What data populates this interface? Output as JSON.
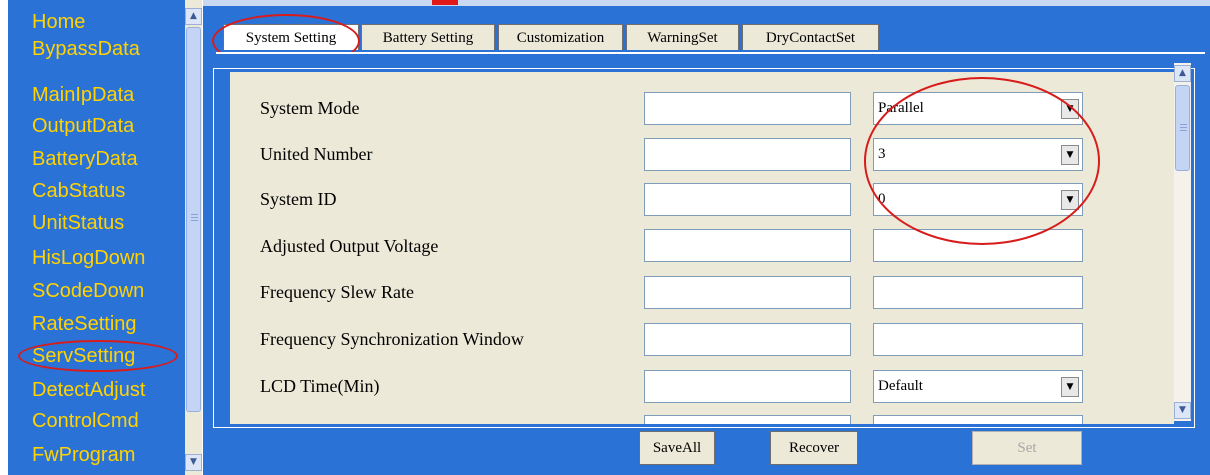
{
  "nav": {
    "items": [
      "Home",
      "BypassData",
      "MainIpData",
      "OutputData",
      "BatteryData",
      "CabStatus",
      "UnitStatus",
      "HisLogDown",
      "SCodeDown",
      "RateSetting",
      "ServSetting",
      "DetectAdjust",
      "ControlCmd",
      "FwProgram"
    ],
    "selected": "ServSetting"
  },
  "tabs": [
    "System Setting",
    "Battery Setting",
    "Customization",
    "WarningSet",
    "DryContactSet"
  ],
  "active_tab": "System Setting",
  "form": {
    "rows": [
      {
        "label": "System Mode",
        "input": "",
        "control": "select",
        "value": "Parallel"
      },
      {
        "label": "United Number",
        "input": "",
        "control": "select",
        "value": "3"
      },
      {
        "label": "System ID",
        "input": "",
        "control": "select",
        "value": "0"
      },
      {
        "label": "Adjusted Output Voltage",
        "input": "",
        "control": "text",
        "value": ""
      },
      {
        "label": "Frequency Slew Rate",
        "input": "",
        "control": "text",
        "value": ""
      },
      {
        "label": "Frequency Synchronization Window",
        "input": "",
        "control": "text",
        "value": ""
      },
      {
        "label": "LCD Time(Min)",
        "input": "",
        "control": "select",
        "value": "Default"
      }
    ]
  },
  "buttons": {
    "save_all": "SaveAll",
    "recover": "Recover",
    "set": "Set"
  },
  "colors": {
    "accent_blue": "#2b72d6",
    "nav_text": "#ffd200",
    "annotation_red": "#d81b1b",
    "panel_bg": "#ece9d8"
  }
}
